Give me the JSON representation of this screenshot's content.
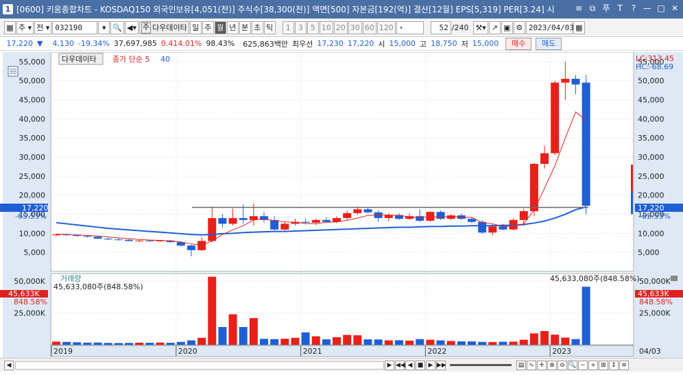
{
  "window": {
    "app_number": "1",
    "title": "[0600] 키움종합차트 - KOSDAQ150 외국인보유[4,051(천)] 주식수[38,300(천)] 액면[500] 자본금[192(억)] 결산[12월] EPS[5,319] PER[3.24] 시",
    "icons": [
      "minimize-all-icon",
      "window-list-icon",
      "pin-icon",
      "text-icon",
      "help-icon",
      "minimize-icon",
      "restore-icon",
      "close-icon"
    ],
    "icon_glyphs": [
      "≡",
      "⧉",
      "푸",
      "T",
      "?",
      "—",
      "□",
      "✕"
    ]
  },
  "toolbar": {
    "period_unit": "주",
    "market": "전",
    "code": "032190",
    "name_label": "주",
    "name": "다우데이타",
    "periods": [
      "일",
      "주",
      "월",
      "년",
      "분",
      "초",
      "틱"
    ],
    "active_period": "월",
    "intervals": [
      "1",
      "3",
      "5",
      "10",
      "20",
      "30",
      "60",
      "120"
    ],
    "count": "52",
    "count_total": "/240",
    "date": "2023/04/03"
  },
  "quote": {
    "price": "17,220",
    "arrow": "▼",
    "change": "4,130",
    "change_pct": "-19.34%",
    "volume": "37,697,985",
    "turnover_pct": "0.414.01%",
    "ratio": "98.43%",
    "amount": "625,863백만",
    "best_label": "최우선",
    "ask": "17,230",
    "bid": "17,220",
    "open_label": "시",
    "open": "15,000",
    "high_label": "고",
    "high": "18,750",
    "low_label": "저",
    "low": "15,000",
    "buy_button": "매수",
    "sell_button": "매도"
  },
  "chart": {
    "legend_name": "다우데이타",
    "legend_ma": "종가 단순 5",
    "legend_ma2": "40",
    "lc_label": "LC:313.45",
    "hc_label": "HC:-68.69",
    "current_price_tag": "17,220",
    "current_pct_tag": "-65.53%",
    "volume_label": "거래량",
    "volume_info_left": "45,633,080주(848.58%)",
    "volume_info_right": "45,633,080주(848.58%)",
    "volume_tag": "45,633K",
    "volume_pct_tag": "848.58%",
    "x_labels": [
      "2019",
      "2020",
      "2021",
      "2022",
      "2023"
    ],
    "x_right_label": "04/03"
  },
  "chart_data": {
    "type": "candlestick",
    "y_ticks": [
      "55,000",
      "50,000",
      "45,000",
      "40,000",
      "35,000",
      "30,000",
      "25,000",
      "20,000",
      "15,000",
      "10,000",
      "5,000"
    ],
    "y_tick_values": [
      55000,
      50000,
      45000,
      40000,
      35000,
      30000,
      25000,
      20000,
      15000,
      10000,
      5000
    ],
    "ylim": [
      0,
      57500
    ],
    "vol_ticks": [
      "50,000K",
      "25,000K"
    ],
    "vol_tick_values": [
      50000,
      25000
    ],
    "vol_ylim": [
      0,
      56000
    ],
    "candles": [
      [
        9500,
        9800,
        9200,
        9700
      ],
      [
        9700,
        9900,
        9400,
        9500
      ],
      [
        9500,
        9700,
        9200,
        9300
      ],
      [
        9300,
        9500,
        8900,
        9100
      ],
      [
        9100,
        9300,
        8500,
        8600
      ],
      [
        8600,
        8900,
        8200,
        8400
      ],
      [
        8400,
        8700,
        8100,
        8300
      ],
      [
        8300,
        8500,
        7900,
        8000
      ],
      [
        8000,
        8300,
        7800,
        8100
      ],
      [
        8100,
        8300,
        7800,
        8000
      ],
      [
        8000,
        8200,
        7700,
        8100
      ],
      [
        8100,
        8300,
        7600,
        7700
      ],
      [
        7700,
        8000,
        6500,
        6800
      ],
      [
        6800,
        7000,
        4000,
        5600
      ],
      [
        5600,
        9000,
        5400,
        8000
      ],
      [
        8000,
        17000,
        7600,
        14000
      ],
      [
        14000,
        15000,
        11500,
        12500
      ],
      [
        12500,
        16500,
        12000,
        14000
      ],
      [
        14000,
        17600,
        12500,
        13500
      ],
      [
        13500,
        17800,
        12000,
        14500
      ],
      [
        14500,
        15500,
        12800,
        13500
      ],
      [
        13500,
        14500,
        10800,
        11000
      ],
      [
        11000,
        13000,
        10500,
        12500
      ],
      [
        12500,
        13800,
        12000,
        13000
      ],
      [
        13000,
        13800,
        12300,
        12800
      ],
      [
        12800,
        13800,
        12200,
        13500
      ],
      [
        13500,
        14200,
        12800,
        13000
      ],
      [
        13000,
        14500,
        12700,
        14000
      ],
      [
        14000,
        16000,
        13500,
        15300
      ],
      [
        15300,
        17000,
        14800,
        16300
      ],
      [
        16300,
        16800,
        15200,
        15500
      ],
      [
        15500,
        16000,
        13000,
        14000
      ],
      [
        14000,
        15300,
        13200,
        14800
      ],
      [
        14800,
        15300,
        13500,
        13800
      ],
      [
        13800,
        15200,
        13500,
        14500
      ],
      [
        14500,
        16300,
        13000,
        13300
      ],
      [
        13300,
        15800,
        13000,
        15600
      ],
      [
        15600,
        16000,
        13500,
        13800
      ],
      [
        13800,
        15000,
        13500,
        14700
      ],
      [
        14700,
        15200,
        13500,
        13800
      ],
      [
        13800,
        14200,
        12700,
        13000
      ],
      [
        13000,
        13500,
        9800,
        10200
      ],
      [
        10200,
        12500,
        9500,
        11800
      ],
      [
        11800,
        12500,
        10800,
        11000
      ],
      [
        11000,
        14000,
        10800,
        13500
      ],
      [
        13500,
        16500,
        12000,
        15800
      ],
      [
        15800,
        28500,
        14500,
        28200
      ],
      [
        28200,
        33000,
        27000,
        31000
      ],
      [
        31000,
        50000,
        30500,
        49500
      ],
      [
        49500,
        55000,
        45000,
        50500
      ],
      [
        50500,
        51500,
        46500,
        49000
      ],
      [
        49500,
        51500,
        15000,
        17220
      ]
    ],
    "ma5": [
      9800,
      9700,
      9600,
      9450,
      9300,
      9050,
      8800,
      8600,
      8400,
      8250,
      8150,
      8050,
      7700,
      7200,
      6900,
      8000,
      9700,
      10900,
      12000,
      13500,
      13800,
      13300,
      13000,
      12900,
      12600,
      12500,
      12900,
      13000,
      13400,
      14000,
      14700,
      14800,
      14800,
      14700,
      14300,
      14100,
      14400,
      14200,
      14500,
      14200,
      14200,
      12800,
      12500,
      11800,
      12000,
      12500,
      16100,
      21800,
      27700,
      35000,
      41800,
      39600
    ],
    "ma40": [
      12800,
      12500,
      12200,
      11900,
      11600,
      11300,
      11100,
      10900,
      10700,
      10500,
      10300,
      10100,
      9900,
      9700,
      9600,
      9700,
      9900,
      10000,
      10200,
      10300,
      10400,
      10500,
      10500,
      10600,
      10700,
      10800,
      10900,
      11000,
      11100,
      11200,
      11300,
      11400,
      11500,
      11600,
      11600,
      11700,
      11800,
      11800,
      11900,
      11900,
      12000,
      12000,
      12000,
      12100,
      12100,
      12300,
      12700,
      13200,
      14000,
      15000,
      16200,
      16900
    ],
    "volumes": [
      2500,
      2300,
      2000,
      1700,
      1800,
      1500,
      1400,
      1500,
      1700,
      1600,
      1800,
      1600,
      2300,
      3500,
      5500,
      53500,
      14000,
      24000,
      14000,
      21000,
      4700,
      4500,
      4800,
      5500,
      9800,
      6700,
      4300,
      6000,
      7800,
      7500,
      4300,
      4200,
      3500,
      3600,
      3300,
      4500,
      4000,
      3500,
      3000,
      2700,
      2700,
      2300,
      2200,
      2400,
      2500,
      4000,
      9000,
      10800,
      8000,
      5700,
      4500,
      45633
    ],
    "resistance_level": 16800
  }
}
